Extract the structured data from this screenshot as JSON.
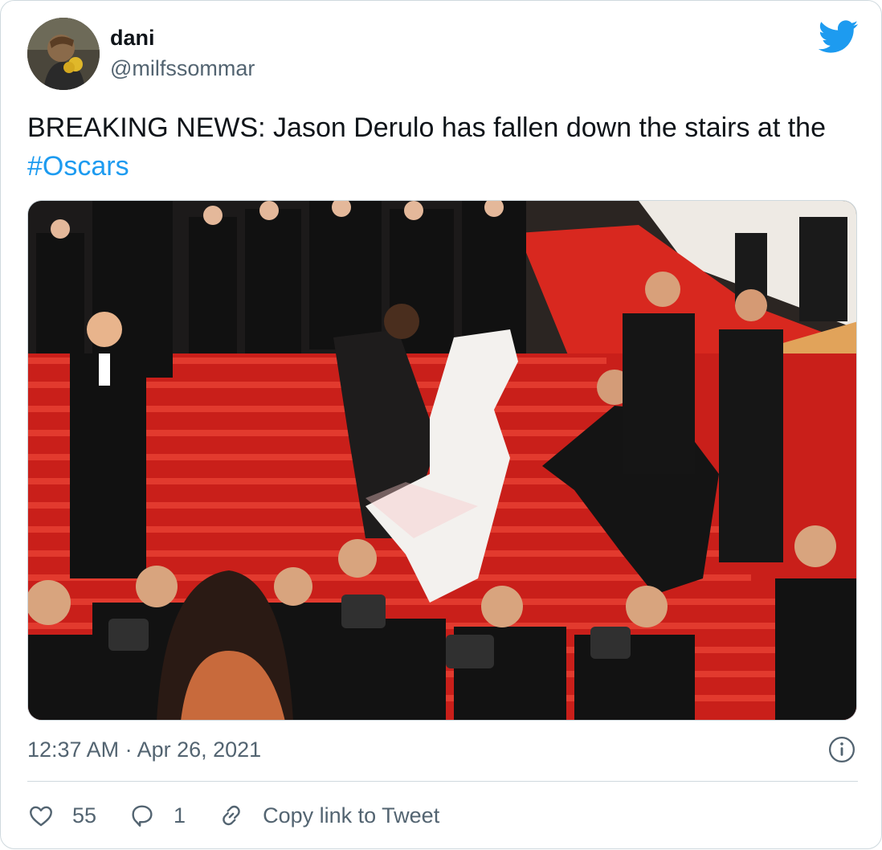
{
  "author": {
    "display_name": "dani",
    "handle": "@milfssommar",
    "avatar_icon": "profile-avatar"
  },
  "brand": {
    "icon": "twitter-bird-icon",
    "color": "#1d9bf0"
  },
  "tweet": {
    "text_before": "BREAKING NEWS: Jason Derulo has fallen down the stairs at the ",
    "hashtag": "#Oscars"
  },
  "media": {
    "description_icon": "photo-red-carpet-stairs"
  },
  "meta": {
    "timestamp": "12:37 AM · Apr 26, 2021",
    "info_icon": "info-icon"
  },
  "actions": {
    "like_count": "55",
    "reply_count": "1",
    "copy_label": "Copy link to Tweet"
  },
  "colors": {
    "text": "#0f1419",
    "secondary": "#536471",
    "border": "#cfd9de",
    "link": "#1d9bf0"
  }
}
